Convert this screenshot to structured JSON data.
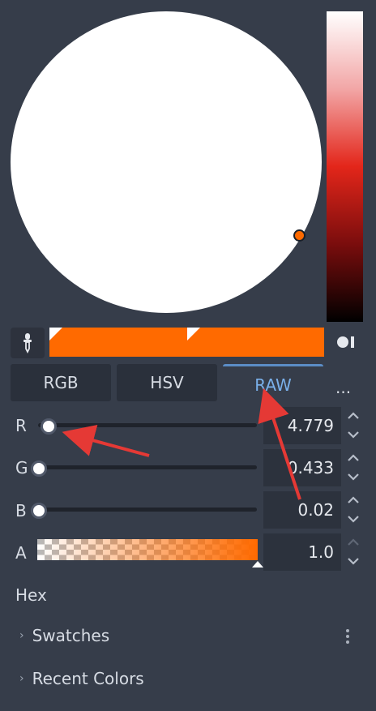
{
  "color": {
    "current_hex": "#ff6a00",
    "wheel_fill": "#ffffff",
    "accent": "#5b8dc6"
  },
  "tabs": [
    {
      "label": "RGB",
      "active": false
    },
    {
      "label": "HSV",
      "active": false
    },
    {
      "label": "RAW",
      "active": true
    }
  ],
  "more_label": "...",
  "channels": [
    {
      "label": "R",
      "value": "4.779",
      "slider_fraction": 0.04
    },
    {
      "label": "G",
      "value": "0.433",
      "slider_fraction": 0.0
    },
    {
      "label": "B",
      "value": "0.02",
      "slider_fraction": 0.0
    },
    {
      "label": "A",
      "value": "1.0",
      "slider_fraction": 1.0
    }
  ],
  "hex_label": "Hex",
  "sections": [
    {
      "label": "Swatches"
    },
    {
      "label": "Recent Colors"
    }
  ],
  "icons": {
    "picker": "eyedropper-icon",
    "shape": "picker-shape-icon",
    "chevron": "chevron-right-icon",
    "kebab": "kebab-menu-icon",
    "spin": "spin-up-down-icon"
  }
}
